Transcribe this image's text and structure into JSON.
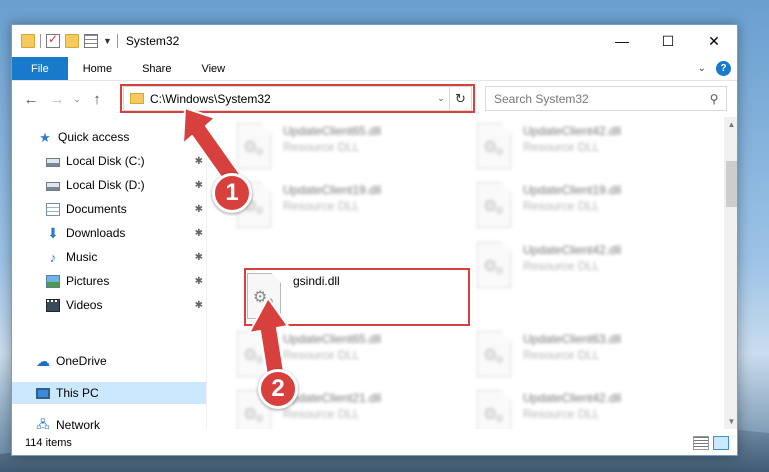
{
  "window": {
    "title": "System32",
    "controls": {
      "minimize": "—",
      "maximize": "☐",
      "close": "✕"
    }
  },
  "ribbon": {
    "tabs": [
      "File",
      "Home",
      "Share",
      "View"
    ],
    "help": "?",
    "collapse": "⌄"
  },
  "nav": {
    "back": "←",
    "forward": "→",
    "recent": "⌄",
    "up": "↑",
    "address": "C:\\Windows\\System32",
    "address_dropdown": "⌄",
    "refresh": "↻",
    "search_placeholder": "Search System32",
    "search_icon": "⚲"
  },
  "sidebar": {
    "items": [
      {
        "label": "Quick access",
        "icon": "star-icon",
        "pinned": false
      },
      {
        "label": "Local Disk (C:)",
        "icon": "drive-icon",
        "pinned": true
      },
      {
        "label": "Local Disk (D:)",
        "icon": "drive-icon",
        "pinned": true
      },
      {
        "label": "Documents",
        "icon": "documents-icon",
        "pinned": true
      },
      {
        "label": "Downloads",
        "icon": "downloads-icon",
        "pinned": true
      },
      {
        "label": "Music",
        "icon": "music-icon",
        "pinned": true
      },
      {
        "label": "Pictures",
        "icon": "pictures-icon",
        "pinned": true
      },
      {
        "label": "Videos",
        "icon": "videos-icon",
        "pinned": true
      },
      {
        "label": "OneDrive",
        "icon": "onedrive-icon",
        "pinned": false
      },
      {
        "label": "This PC",
        "icon": "this-pc-icon",
        "pinned": false,
        "selected": true
      },
      {
        "label": "Network",
        "icon": "network-icon",
        "pinned": false
      }
    ],
    "pin_glyph": "📌"
  },
  "files": [
    {
      "name": "UpdateClient65.dll",
      "type": "Resource DLL",
      "blurred": true
    },
    {
      "name": "UpdateClient42.dll",
      "type": "Resource DLL",
      "blurred": true
    },
    {
      "name": "UpdateClient19.dll",
      "type": "Resource DLL",
      "blurred": true
    },
    {
      "name": "UpdateClient19.dll",
      "type": "Resource DLL",
      "blurred": true
    },
    {
      "name": "gsindi.dll",
      "type": "",
      "blurred": false,
      "highlighted": true
    },
    {
      "name": "UpdateClient42.dll",
      "type": "Resource DLL",
      "blurred": true
    },
    {
      "name": "UpdateClient65.dll",
      "type": "Resource DLL",
      "blurred": true
    },
    {
      "name": "UpdateClient63.dll",
      "type": "Resource DLL",
      "blurred": true
    },
    {
      "name": "UpdateClient21.dll",
      "type": "Resource DLL",
      "blurred": true
    },
    {
      "name": "UpdateClient42.dll",
      "type": "Resource DLL",
      "blurred": true
    }
  ],
  "scrollbar": {
    "up": "▲",
    "down": "▼"
  },
  "status": {
    "item_count": "114 items"
  },
  "callouts": {
    "step1": "1",
    "step2": "2",
    "color": "#d8403e"
  }
}
